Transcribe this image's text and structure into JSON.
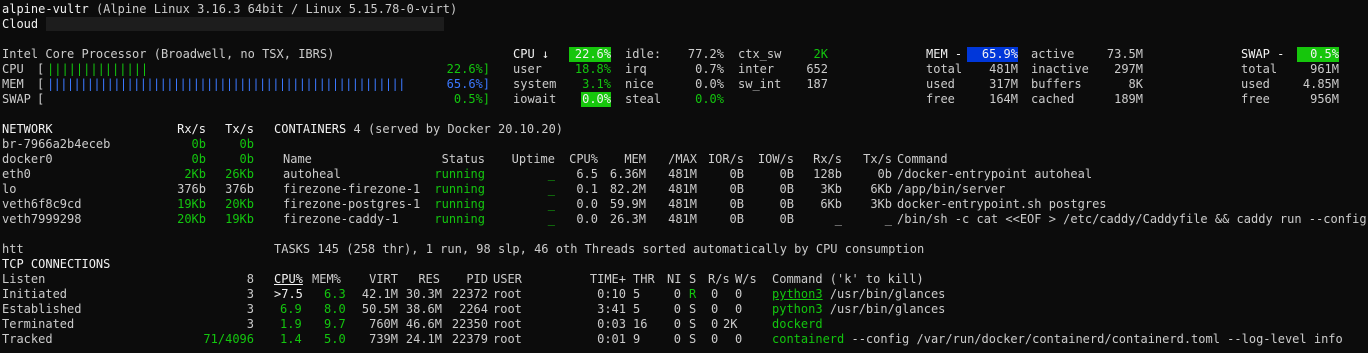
{
  "header": {
    "hostname": "alpine-vultr",
    "os": "(Alpine Linux 3.16.3 64bit / Linux 5.15.78-0-virt)",
    "cloud_label": "Cloud"
  },
  "cpu_summary": {
    "processor": "Intel Core Processor (Broadwell, no TSX, IBRS)",
    "cpu_label": "CPU",
    "cpu_bar": "||||||||||||||",
    "cpu_pct": "22.6%]",
    "mem_label": "MEM",
    "mem_bar": "||||||||||||||||||||||||||||||||||||||||||||||||||||||",
    "mem_pct": "65.6%]",
    "swap_label": "SWAP",
    "swap_pct": "0.5%]"
  },
  "cpu_detail": {
    "title": "CPU ↓",
    "total": "22.6%",
    "rows": [
      {
        "k1": "user",
        "v1": "18.8%",
        "k2": "irq",
        "v2": "0.7%",
        "k3": "inter",
        "v3": "652"
      },
      {
        "k1": "system",
        "v1": "3.1%",
        "k2": "nice",
        "v2": "0.0%",
        "k3": "sw_int",
        "v3": "187"
      },
      {
        "k1": "iowait",
        "v1": "0.0%",
        "k2": "steal",
        "v2": "0.0%",
        "k3": "",
        "v3": ""
      }
    ],
    "idle_label": "idle:",
    "idle_val": "77.2%",
    "ctx_label": "ctx_sw",
    "ctx_val": "2K"
  },
  "mem": {
    "title": "MEM -",
    "pct": "65.9%",
    "active_label": "active",
    "active_val": "73.5M",
    "rows": [
      {
        "k1": "total",
        "v1": "481M",
        "k2": "inactive",
        "v2": "297M"
      },
      {
        "k1": "used",
        "v1": "317M",
        "k2": "buffers",
        "v2": "8K"
      },
      {
        "k1": "free",
        "v1": "164M",
        "k2": "cached",
        "v2": "189M"
      }
    ]
  },
  "swap": {
    "title": "SWAP -",
    "pct": "0.5%",
    "rows": [
      {
        "k": "total",
        "v": "961M"
      },
      {
        "k": "used",
        "v": "4.85M"
      },
      {
        "k": "free",
        "v": "956M"
      }
    ]
  },
  "network": {
    "title": "NETWORK",
    "rx_h": "Rx/s",
    "tx_h": "Tx/s",
    "rows": [
      {
        "name": "br-7966a2b4eceb",
        "rx": "0b",
        "tx": "0b"
      },
      {
        "name": "docker0",
        "rx": "0b",
        "tx": "0b"
      },
      {
        "name": "eth0",
        "rx": "2Kb",
        "tx": "26Kb"
      },
      {
        "name": "lo",
        "rx": "376b",
        "tx": "376b"
      },
      {
        "name": "veth6f8c9cd",
        "rx": "19Kb",
        "tx": "20Kb"
      },
      {
        "name": "veth7999298",
        "rx": "20Kb",
        "tx": "19Kb"
      }
    ]
  },
  "containers": {
    "title": "CONTAINERS",
    "count": "4",
    "served": "(served by Docker 20.10.20)",
    "headers": [
      "Name",
      "Status",
      "Uptime",
      "CPU%",
      "MEM",
      "/MAX",
      "IOR/s",
      "IOW/s",
      "Rx/s",
      "Tx/s",
      "Command"
    ],
    "rows": [
      {
        "name": "autoheal",
        "status": "running",
        "uptime": "_",
        "cpu": "6.5",
        "mem": "6.36M",
        "max": "481M",
        "ior": "0B",
        "iow": "0B",
        "rx": "128b",
        "tx": "0b",
        "cmd": "/docker-entrypoint autoheal"
      },
      {
        "name": "firezone-firezone-1",
        "status": "running",
        "uptime": "_",
        "cpu": "0.1",
        "mem": "82.2M",
        "max": "481M",
        "ior": "0B",
        "iow": "0B",
        "rx": "3Kb",
        "tx": "6Kb",
        "cmd": "/app/bin/server"
      },
      {
        "name": "firezone-postgres-1",
        "status": "running",
        "uptime": "_",
        "cpu": "0.0",
        "mem": "59.9M",
        "max": "481M",
        "ior": "0B",
        "iow": "0B",
        "rx": "6Kb",
        "tx": "3Kb",
        "cmd": "docker-entrypoint.sh postgres"
      },
      {
        "name": "firezone-caddy-1",
        "status": "running",
        "uptime": "_",
        "cpu": "0.0",
        "mem": "26.3M",
        "max": "481M",
        "ior": "0B",
        "iow": "0B",
        "rx": "_",
        "tx": "_",
        "cmd": "/bin/sh -c cat <<EOF > /etc/caddy/Caddyfile && caddy run --config /"
      }
    ]
  },
  "htt_label": "htt",
  "tasks": {
    "line": "TASKS 145 (258 thr), 1 run, 98 slp, 46 oth Threads sorted automatically by CPU consumption",
    "headers": {
      "cpu": "CPU%",
      "mem": "MEM%",
      "virt": "VIRT",
      "res": "RES",
      "pid": "PID",
      "user": "USER",
      "time": "TIME+",
      "thr": "THR",
      "ni": "NI",
      "s": "S",
      "rs": "R/s",
      "ws": "W/s",
      "cmd": "Command ('k' to kill)"
    },
    "rows": [
      {
        "cpu": ">7.5",
        "mem": "6.3",
        "virt": "42.1M",
        "res": "30.3M",
        "pid": "22372",
        "user": "root",
        "time": "0:10",
        "thr": "5",
        "ni": "0",
        "s": "R",
        "rs": "0",
        "ws": "0",
        "prog": "python3",
        "args": "/usr/bin/glances"
      },
      {
        "cpu": "6.9",
        "mem": "8.0",
        "virt": "50.5M",
        "res": "38.6M",
        "pid": "2264",
        "user": "root",
        "time": "3:41",
        "thr": "5",
        "ni": "0",
        "s": "S",
        "rs": "0",
        "ws": "0",
        "prog": "python3",
        "args": "/usr/bin/glances"
      },
      {
        "cpu": "1.9",
        "mem": "9.7",
        "virt": "760M",
        "res": "46.6M",
        "pid": "22350",
        "user": "root",
        "time": "0:03",
        "thr": "16",
        "ni": "0",
        "s": "S",
        "rs": "0",
        "ws": "2K",
        "prog": "dockerd",
        "args": ""
      },
      {
        "cpu": "1.4",
        "mem": "5.0",
        "virt": "739M",
        "res": "24.1M",
        "pid": "22379",
        "user": "root",
        "time": "0:01",
        "thr": "9",
        "ni": "0",
        "s": "S",
        "rs": "0",
        "ws": "0",
        "prog": "containerd",
        "args": "--config /var/run/docker/containerd/containerd.toml --log-level info"
      }
    ]
  },
  "tcp": {
    "title": "TCP CONNECTIONS",
    "rows": [
      {
        "k": "Listen",
        "v": "8"
      },
      {
        "k": "Initiated",
        "v": "3"
      },
      {
        "k": "Established",
        "v": "3"
      },
      {
        "k": "Terminated",
        "v": "3"
      },
      {
        "k": "Tracked",
        "v": "71/4096"
      }
    ]
  }
}
